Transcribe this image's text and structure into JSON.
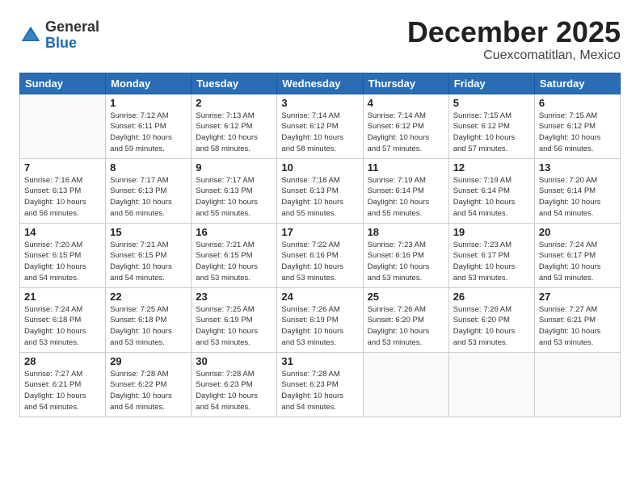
{
  "logo": {
    "general": "General",
    "blue": "Blue"
  },
  "title": "December 2025",
  "subtitle": "Cuexcomatitlan, Mexico",
  "days_of_week": [
    "Sunday",
    "Monday",
    "Tuesday",
    "Wednesday",
    "Thursday",
    "Friday",
    "Saturday"
  ],
  "weeks": [
    [
      {
        "day": "",
        "info": ""
      },
      {
        "day": "1",
        "info": "Sunrise: 7:12 AM\nSunset: 6:11 PM\nDaylight: 10 hours\nand 59 minutes."
      },
      {
        "day": "2",
        "info": "Sunrise: 7:13 AM\nSunset: 6:12 PM\nDaylight: 10 hours\nand 58 minutes."
      },
      {
        "day": "3",
        "info": "Sunrise: 7:14 AM\nSunset: 6:12 PM\nDaylight: 10 hours\nand 58 minutes."
      },
      {
        "day": "4",
        "info": "Sunrise: 7:14 AM\nSunset: 6:12 PM\nDaylight: 10 hours\nand 57 minutes."
      },
      {
        "day": "5",
        "info": "Sunrise: 7:15 AM\nSunset: 6:12 PM\nDaylight: 10 hours\nand 57 minutes."
      },
      {
        "day": "6",
        "info": "Sunrise: 7:15 AM\nSunset: 6:12 PM\nDaylight: 10 hours\nand 56 minutes."
      }
    ],
    [
      {
        "day": "7",
        "info": "Sunrise: 7:16 AM\nSunset: 6:13 PM\nDaylight: 10 hours\nand 56 minutes."
      },
      {
        "day": "8",
        "info": "Sunrise: 7:17 AM\nSunset: 6:13 PM\nDaylight: 10 hours\nand 56 minutes."
      },
      {
        "day": "9",
        "info": "Sunrise: 7:17 AM\nSunset: 6:13 PM\nDaylight: 10 hours\nand 55 minutes."
      },
      {
        "day": "10",
        "info": "Sunrise: 7:18 AM\nSunset: 6:13 PM\nDaylight: 10 hours\nand 55 minutes."
      },
      {
        "day": "11",
        "info": "Sunrise: 7:19 AM\nSunset: 6:14 PM\nDaylight: 10 hours\nand 55 minutes."
      },
      {
        "day": "12",
        "info": "Sunrise: 7:19 AM\nSunset: 6:14 PM\nDaylight: 10 hours\nand 54 minutes."
      },
      {
        "day": "13",
        "info": "Sunrise: 7:20 AM\nSunset: 6:14 PM\nDaylight: 10 hours\nand 54 minutes."
      }
    ],
    [
      {
        "day": "14",
        "info": "Sunrise: 7:20 AM\nSunset: 6:15 PM\nDaylight: 10 hours\nand 54 minutes."
      },
      {
        "day": "15",
        "info": "Sunrise: 7:21 AM\nSunset: 6:15 PM\nDaylight: 10 hours\nand 54 minutes."
      },
      {
        "day": "16",
        "info": "Sunrise: 7:21 AM\nSunset: 6:15 PM\nDaylight: 10 hours\nand 53 minutes."
      },
      {
        "day": "17",
        "info": "Sunrise: 7:22 AM\nSunset: 6:16 PM\nDaylight: 10 hours\nand 53 minutes."
      },
      {
        "day": "18",
        "info": "Sunrise: 7:23 AM\nSunset: 6:16 PM\nDaylight: 10 hours\nand 53 minutes."
      },
      {
        "day": "19",
        "info": "Sunrise: 7:23 AM\nSunset: 6:17 PM\nDaylight: 10 hours\nand 53 minutes."
      },
      {
        "day": "20",
        "info": "Sunrise: 7:24 AM\nSunset: 6:17 PM\nDaylight: 10 hours\nand 53 minutes."
      }
    ],
    [
      {
        "day": "21",
        "info": "Sunrise: 7:24 AM\nSunset: 6:18 PM\nDaylight: 10 hours\nand 53 minutes."
      },
      {
        "day": "22",
        "info": "Sunrise: 7:25 AM\nSunset: 6:18 PM\nDaylight: 10 hours\nand 53 minutes."
      },
      {
        "day": "23",
        "info": "Sunrise: 7:25 AM\nSunset: 6:19 PM\nDaylight: 10 hours\nand 53 minutes."
      },
      {
        "day": "24",
        "info": "Sunrise: 7:26 AM\nSunset: 6:19 PM\nDaylight: 10 hours\nand 53 minutes."
      },
      {
        "day": "25",
        "info": "Sunrise: 7:26 AM\nSunset: 6:20 PM\nDaylight: 10 hours\nand 53 minutes."
      },
      {
        "day": "26",
        "info": "Sunrise: 7:26 AM\nSunset: 6:20 PM\nDaylight: 10 hours\nand 53 minutes."
      },
      {
        "day": "27",
        "info": "Sunrise: 7:27 AM\nSunset: 6:21 PM\nDaylight: 10 hours\nand 53 minutes."
      }
    ],
    [
      {
        "day": "28",
        "info": "Sunrise: 7:27 AM\nSunset: 6:21 PM\nDaylight: 10 hours\nand 54 minutes."
      },
      {
        "day": "29",
        "info": "Sunrise: 7:28 AM\nSunset: 6:22 PM\nDaylight: 10 hours\nand 54 minutes."
      },
      {
        "day": "30",
        "info": "Sunrise: 7:28 AM\nSunset: 6:23 PM\nDaylight: 10 hours\nand 54 minutes."
      },
      {
        "day": "31",
        "info": "Sunrise: 7:28 AM\nSunset: 6:23 PM\nDaylight: 10 hours\nand 54 minutes."
      },
      {
        "day": "",
        "info": ""
      },
      {
        "day": "",
        "info": ""
      },
      {
        "day": "",
        "info": ""
      }
    ]
  ]
}
